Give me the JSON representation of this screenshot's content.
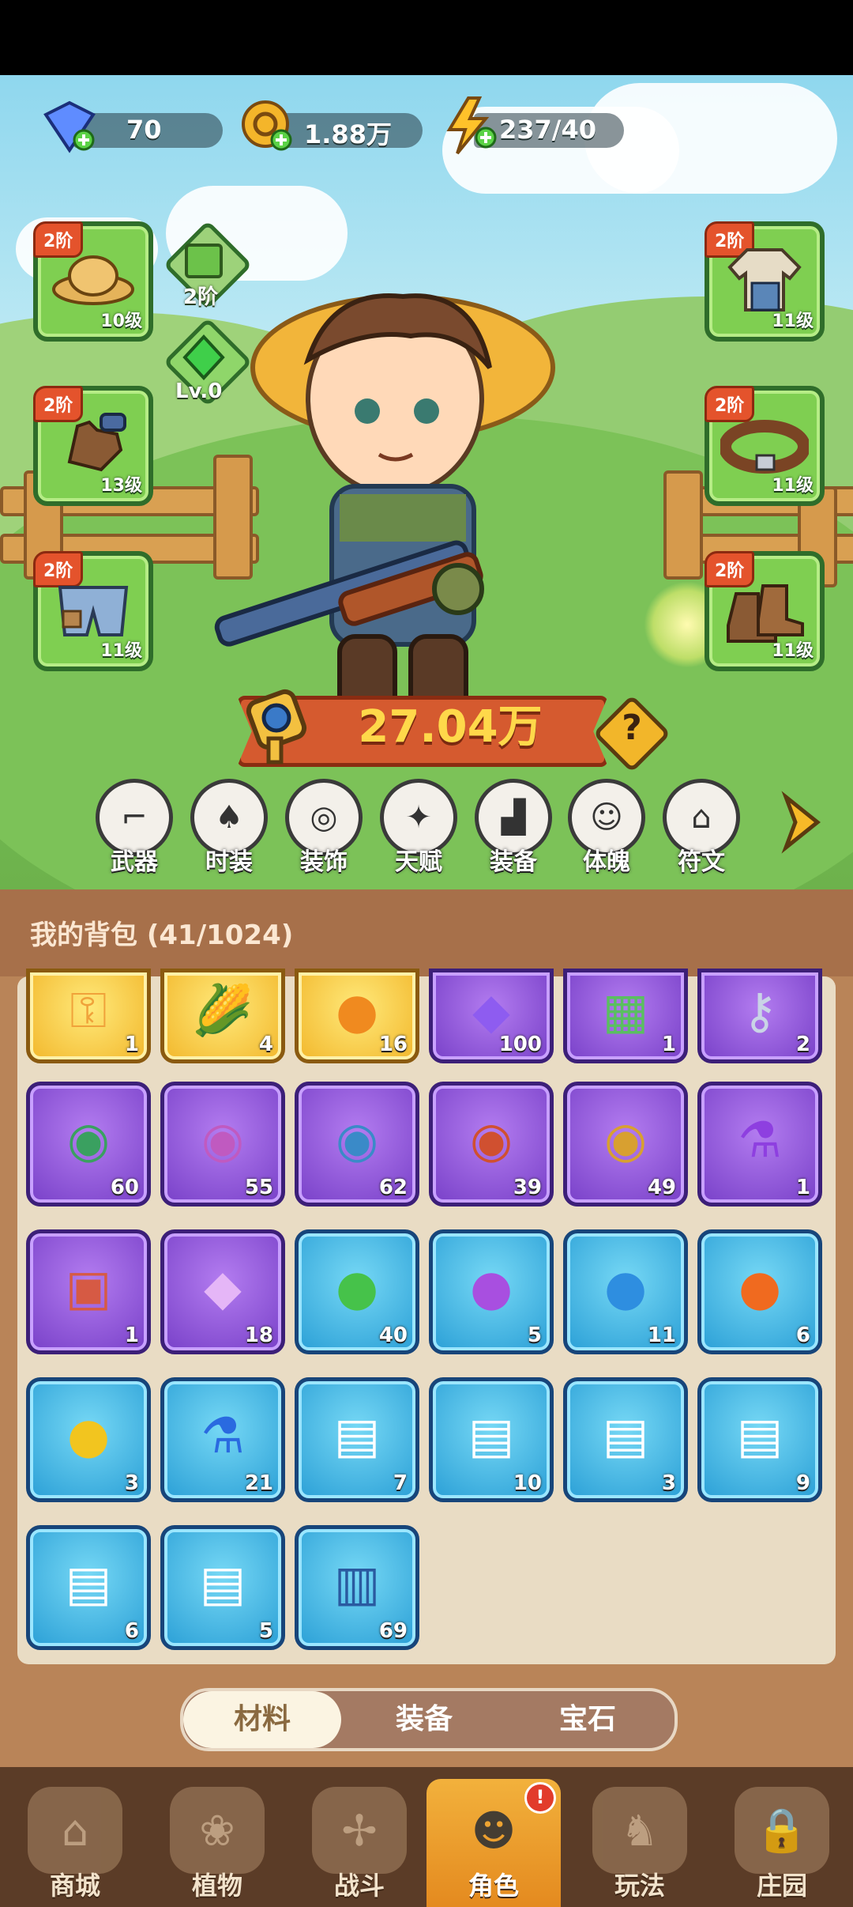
{
  "resources": {
    "diamond": "70",
    "gold": "1.88万",
    "energy": "237/40"
  },
  "left_slots": [
    {
      "tier": "2阶",
      "level": "10级",
      "icon": "straw-hat-icon"
    },
    {
      "tier": "2阶",
      "level": "13级",
      "icon": "glove-icon"
    },
    {
      "tier": "2阶",
      "level": "11级",
      "icon": "shorts-icon"
    }
  ],
  "right_slots": [
    {
      "tier": "2阶",
      "level": "11级",
      "icon": "shirt-icon"
    },
    {
      "tier": "2阶",
      "level": "11级",
      "icon": "belt-icon"
    },
    {
      "tier": "2阶",
      "level": "11级",
      "icon": "boots-icon"
    }
  ],
  "mid_slots": [
    {
      "label": "2阶",
      "icon": "green-map-icon"
    },
    {
      "label": "Lv.0",
      "icon": "green-gem-icon"
    }
  ],
  "power": "27.04万",
  "menu": [
    "武器",
    "时装",
    "装饰",
    "天赋",
    "装备",
    "体魄",
    "符文"
  ],
  "bag": {
    "title": "我的背包 (41/1024)",
    "rows": [
      [
        {
          "count": "1",
          "color": "gold",
          "icon": "key-icon"
        },
        {
          "count": "4",
          "color": "gold",
          "icon": "corn-icon"
        },
        {
          "count": "16",
          "color": "gold",
          "icon": "orange-fruit-icon"
        },
        {
          "count": "100",
          "color": "purple",
          "icon": "purple-crystal-icon"
        },
        {
          "count": "1",
          "color": "purple",
          "icon": "map-icon"
        },
        {
          "count": "2",
          "color": "purple",
          "icon": "silver-key-icon"
        }
      ],
      [
        {
          "count": "60",
          "color": "purple",
          "icon": "scroll-green-icon"
        },
        {
          "count": "55",
          "color": "purple",
          "icon": "scroll-pink-icon"
        },
        {
          "count": "62",
          "color": "purple",
          "icon": "scroll-blue-icon"
        },
        {
          "count": "39",
          "color": "purple",
          "icon": "scroll-red-icon"
        },
        {
          "count": "49",
          "color": "purple",
          "icon": "scroll-yellow-icon"
        },
        {
          "count": "1",
          "color": "purple",
          "icon": "purple-potion-icon"
        }
      ],
      [
        {
          "count": "1",
          "color": "purple",
          "icon": "tractor-card-icon"
        },
        {
          "count": "18",
          "color": "purple",
          "icon": "pink-crystal-icon"
        },
        {
          "count": "40",
          "color": "blue",
          "icon": "green-orb-icon"
        },
        {
          "count": "5",
          "color": "blue",
          "icon": "purple-orb-icon"
        },
        {
          "count": "11",
          "color": "blue",
          "icon": "water-orb-icon"
        },
        {
          "count": "6",
          "color": "blue",
          "icon": "fire-orb-icon"
        }
      ],
      [
        {
          "count": "3",
          "color": "blue",
          "icon": "lightning-orb-icon"
        },
        {
          "count": "21",
          "color": "blue",
          "icon": "blue-potion-icon"
        },
        {
          "count": "7",
          "color": "blue",
          "icon": "hat-blueprint-icon"
        },
        {
          "count": "10",
          "color": "blue",
          "icon": "shirt-blueprint-icon"
        },
        {
          "count": "3",
          "color": "blue",
          "icon": "glove-blueprint-icon"
        },
        {
          "count": "9",
          "color": "blue",
          "icon": "belt-blueprint-icon"
        }
      ],
      [
        {
          "count": "6",
          "color": "blue",
          "icon": "pants-blueprint-icon"
        },
        {
          "count": "5",
          "color": "blue",
          "icon": "boots-blueprint-icon"
        },
        {
          "count": "69",
          "color": "blue",
          "icon": "blue-book-icon"
        }
      ]
    ]
  },
  "tabs": [
    "材料",
    "装备",
    "宝石"
  ],
  "nav": [
    {
      "label": "商城",
      "icon": "shop-icon"
    },
    {
      "label": "植物",
      "icon": "plant-icon"
    },
    {
      "label": "战斗",
      "icon": "windmill-icon"
    },
    {
      "label": "角色",
      "icon": "character-icon"
    },
    {
      "label": "玩法",
      "icon": "monster-icon"
    },
    {
      "label": "庄园",
      "icon": "lock-icon"
    }
  ],
  "colors": {
    "tier_badge": "#e4532c",
    "slot_green": "#7fcf51",
    "power_text": "#ffd84a",
    "nav_active": "#f2b13c"
  }
}
